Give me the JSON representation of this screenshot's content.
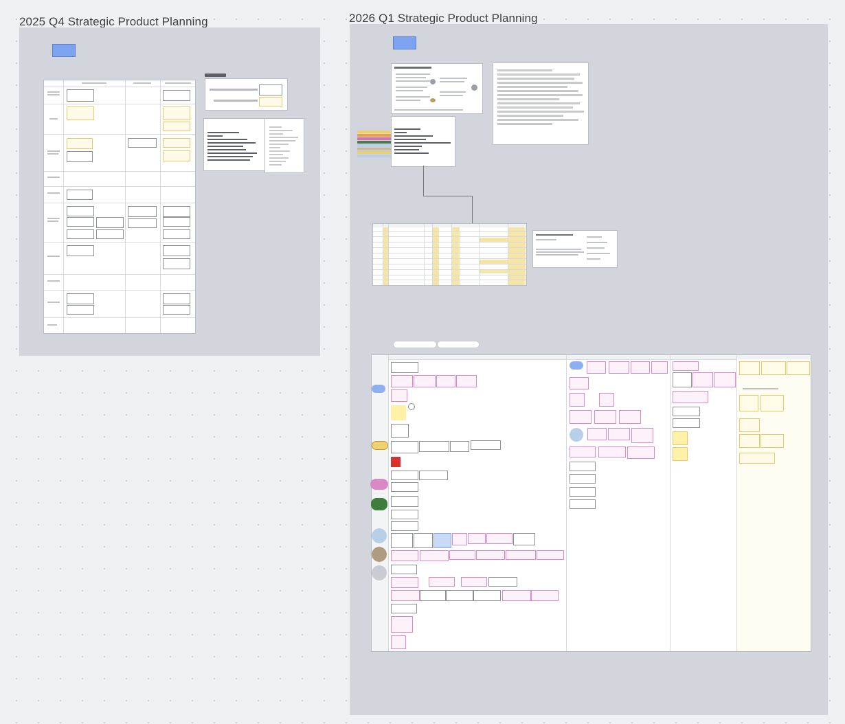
{
  "frames": {
    "left_title": "2025 Q4 Strategic Product Planning",
    "right_title": "2026 Q1 Strategic Product Planning"
  },
  "colors": {
    "canvas": "#eef0f3",
    "section": "#d2d6dc",
    "sticky_blue": "#7da2f0",
    "sticky_yellow": "#fff1a8",
    "pink": "#d98ac4",
    "red": "#d93030",
    "green": "#3f7d3a"
  },
  "icons": [
    "sticky-note-icon",
    "circle-tag-icon"
  ]
}
